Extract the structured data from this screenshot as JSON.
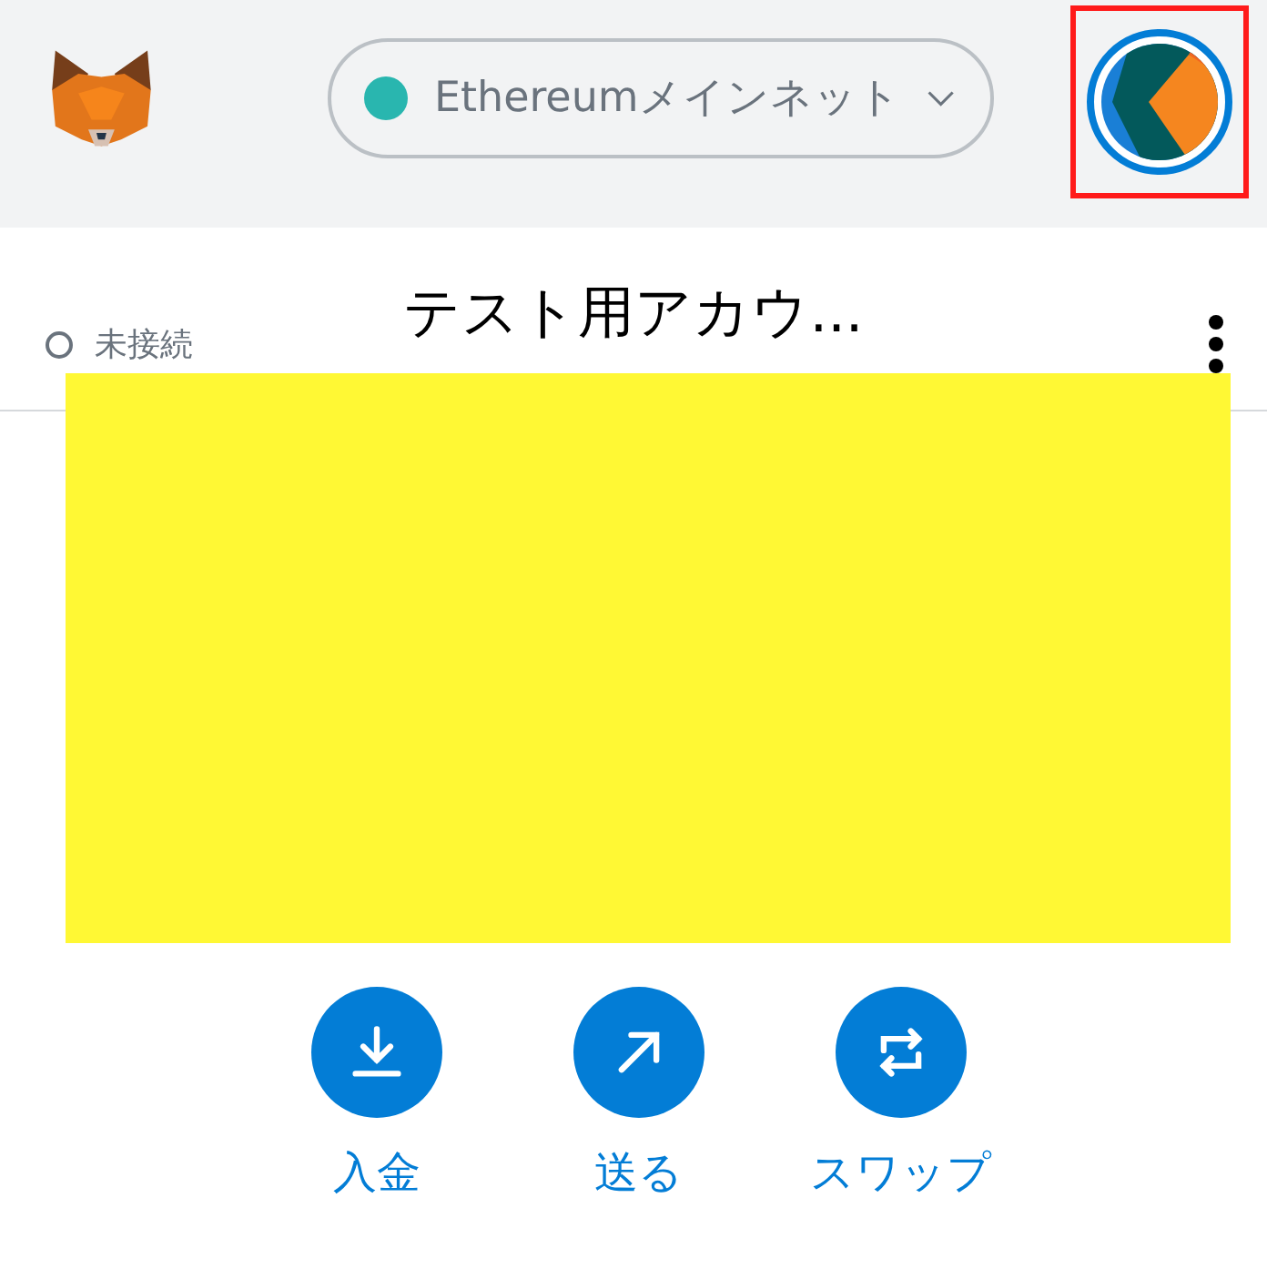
{
  "network": {
    "label": "Ethereumメインネット",
    "color": "#29b6af"
  },
  "account": {
    "status": "未接続",
    "name": "テスト用アカウ..."
  },
  "actions": [
    {
      "kind": "deposit",
      "label": "入金"
    },
    {
      "kind": "send",
      "label": "送る"
    },
    {
      "kind": "swap",
      "label": "スワップ"
    }
  ]
}
